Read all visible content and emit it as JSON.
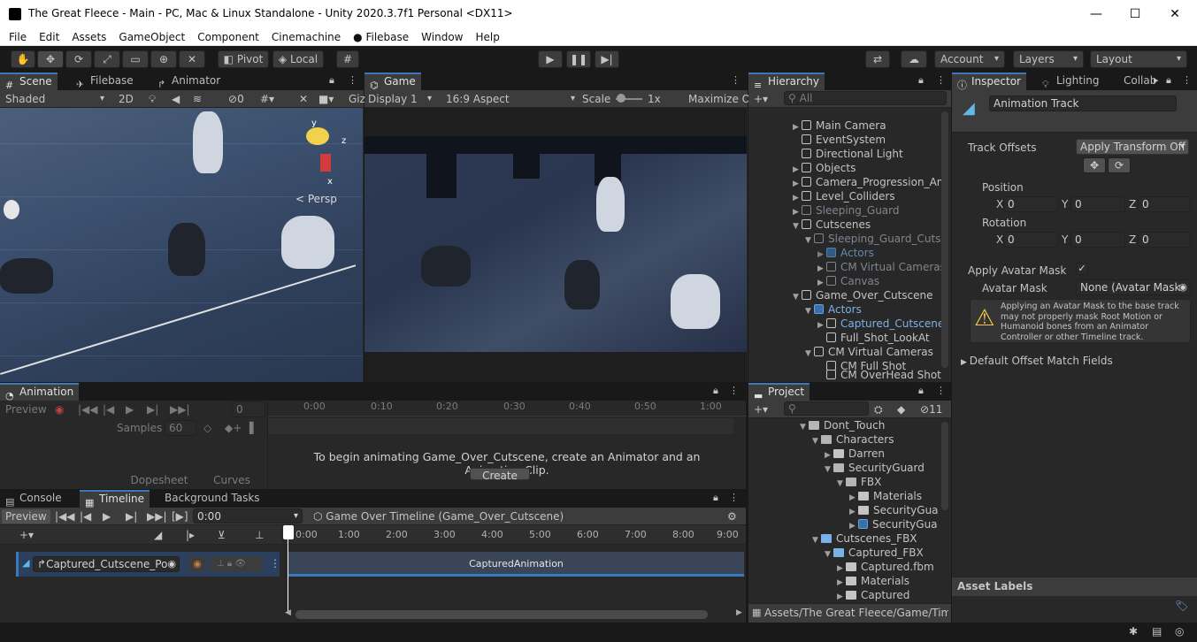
{
  "window": {
    "title": "The Great Fleece - Main - PC, Mac & Linux Standalone - Unity 2020.3.7f1 Personal <DX11>",
    "minimize": "—",
    "maximize": "☐",
    "close": "✕"
  },
  "menu": [
    "File",
    "Edit",
    "Assets",
    "GameObject",
    "Component",
    "Cinemachine",
    "● Filebase",
    "Window",
    "Help"
  ],
  "toolbar": {
    "pivot": "Pivot",
    "local": "Local",
    "account": "Account",
    "layers": "Layers",
    "layout": "Layout"
  },
  "scene_panel": {
    "tabs": [
      "Scene",
      "Filebase",
      "Animator"
    ],
    "shading": "Shaded",
    "mode_2d": "2D",
    "hidden_count": "0",
    "gizmos": "Giz",
    "persp": "Persp",
    "axis_y": "y",
    "axis_z": "z",
    "axis_x": "x"
  },
  "game_panel": {
    "tab": "Game",
    "display": "Display 1",
    "aspect": "16:9 Aspect",
    "scale_label": "Scale",
    "scale_value": "1x",
    "maximize": "Maximize O"
  },
  "hierarchy": {
    "tab": "Hierarchy",
    "search_placeholder": "All",
    "items": [
      {
        "label": "Main Camera"
      },
      {
        "label": "EventSystem"
      },
      {
        "label": "Directional Light"
      },
      {
        "label": "Objects"
      },
      {
        "label": "Camera_Progression_An"
      },
      {
        "label": "Level_Colliders"
      },
      {
        "label": "Sleeping_Guard"
      },
      {
        "label": "Cutscenes"
      },
      {
        "label": "Sleeping_Guard_Cutsc"
      },
      {
        "label": "Actors"
      },
      {
        "label": "CM Virtual Cameras"
      },
      {
        "label": "Canvas"
      },
      {
        "label": "Game_Over_Cutscene"
      },
      {
        "label": "Actors"
      },
      {
        "label": "Captured_Cutscene"
      },
      {
        "label": "Full_Shot_LookAt"
      },
      {
        "label": "CM Virtual Cameras"
      },
      {
        "label": "CM Full Shot"
      },
      {
        "label": "CM OverHead Shot"
      }
    ]
  },
  "inspector": {
    "tabs": [
      "Inspector",
      "Lighting",
      "Collab"
    ],
    "object_name": "Animation Track",
    "track_offsets_label": "Track Offsets",
    "track_offsets_value": "Apply Transform Off",
    "position_label": "Position",
    "rotation_label": "Rotation",
    "pos": {
      "x": "0",
      "y": "0",
      "z": "0"
    },
    "rot": {
      "x": "0",
      "y": "0",
      "z": "0"
    },
    "x_label": "X",
    "y_label": "Y",
    "z_label": "Z",
    "apply_avatar_mask_label": "Apply Avatar Mask",
    "avatar_mask_label": "Avatar Mask",
    "avatar_mask_value": "None (Avatar Mask",
    "warning": "Applying an Avatar Mask to the base track may not properly mask Root Motion or Humanoid bones from an Animator Controller or other Timeline track.",
    "default_offset": "Default Offset Match Fields",
    "asset_labels": "Asset Labels"
  },
  "animation_panel": {
    "tab": "Animation",
    "preview": "Preview",
    "frame": "0",
    "samples_label": "Samples",
    "samples_value": "60",
    "ruler": [
      "0:00",
      "0:10",
      "0:20",
      "0:30",
      "0:40",
      "0:50",
      "1:00"
    ],
    "message": "To begin animating Game_Over_Cutscene, create an Animator and an Animation Clip.",
    "create_button": "Create",
    "dopesheet": "Dopesheet",
    "curves": "Curves"
  },
  "timeline_panel": {
    "tabs": [
      "Console",
      "Timeline",
      "Background Tasks"
    ],
    "preview": "Preview",
    "time": "0:00",
    "asset": "Game Over Timeline (Game_Over_Cutscene)",
    "ruler": [
      "0:00",
      "1:00",
      "2:00",
      "3:00",
      "4:00",
      "5:00",
      "6:00",
      "7:00",
      "8:00",
      "9:00"
    ],
    "track_name": "Captured_Cutscene_Po",
    "clip_name": "CapturedAnimation"
  },
  "project": {
    "tab": "Project",
    "hidden_count": "11",
    "items": [
      {
        "label": "Dont_Touch"
      },
      {
        "label": "Characters"
      },
      {
        "label": "Darren"
      },
      {
        "label": "SecurityGuard"
      },
      {
        "label": "FBX"
      },
      {
        "label": "Materials"
      },
      {
        "label": "SecurityGua"
      },
      {
        "label": "SecurityGua"
      },
      {
        "label": "Cutscenes_FBX"
      },
      {
        "label": "Captured_FBX"
      },
      {
        "label": "Captured.fbm"
      },
      {
        "label": "Materials"
      },
      {
        "label": "Captured"
      }
    ],
    "path": "Assets/The Great Fleece/Game/Time"
  },
  "colors": {
    "accent": "#3a79bb",
    "timeline_track": "#2b3f5f",
    "clip": "#3a4557"
  }
}
